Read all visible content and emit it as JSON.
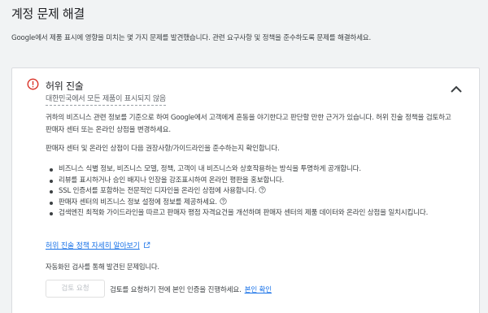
{
  "page": {
    "title": "계정 문제 해결",
    "description": "Google에서 제품 표시에 영향을 미치는 몇 가지 문제를 발견했습니다. 관련 요구사항 및 정책을 준수하도록 문제를 해결하세요."
  },
  "issue": {
    "title": "허위 진술",
    "subtitle": "대한민국에서 모든 제품이 표시되지 않음",
    "paragraph1": "귀하의 비즈니스 관련 정보를 기준으로 하여 Google에서 고객에게 혼동을 야기한다고 판단할 만한 근거가 있습니다. 허위 진술 정책을 검토하고 판매자 센터 또는 온라인 상점을 변경하세요.",
    "paragraph2": "판매자 센터 및 온라인 상점이 다음 권장사항/가이드라인을 준수하는지 확인합니다.",
    "bullets": [
      "비즈니스 식별 정보, 비즈니스 모델, 정책, 고객이 내 비즈니스와 상호작용하는 방식을 투명하게 공개합니다.",
      "리뷰를 표시하거나 승인 배지나 인장을 강조표시하여 온라인 평판을 홍보합니다.",
      "SSL 인증서를 포함하는 전문적인 디자인을 온라인 상점에 사용합니다.",
      "판매자 센터의 비즈니스 정보 설정에 정보를 제공하세요.",
      "검색엔진 최적화 가이드라인을 따르고 판매자 평점 자격요건을 개선하며 판매자 센터의 제품 데이터와 온라인 상점을 일치시킵니다."
    ],
    "learn_more": "허위 진술 정책 자세히 알아보기",
    "auto_note": "자동화된 검사를 통해 발견된 문제입니다.",
    "review_button": "검토 요청",
    "verify_text": "검토를 요청하기 전에 본인 인증을 진행하세요.",
    "verify_link": "본인 확인"
  },
  "icons": {
    "error": "error-circle-icon",
    "collapse": "chevron-up-icon",
    "help": "help-circle-icon",
    "external": "open-in-new-icon"
  },
  "colors": {
    "error_red": "#d93025",
    "link_blue": "#1a73e8",
    "background": "#f1f3f4"
  }
}
